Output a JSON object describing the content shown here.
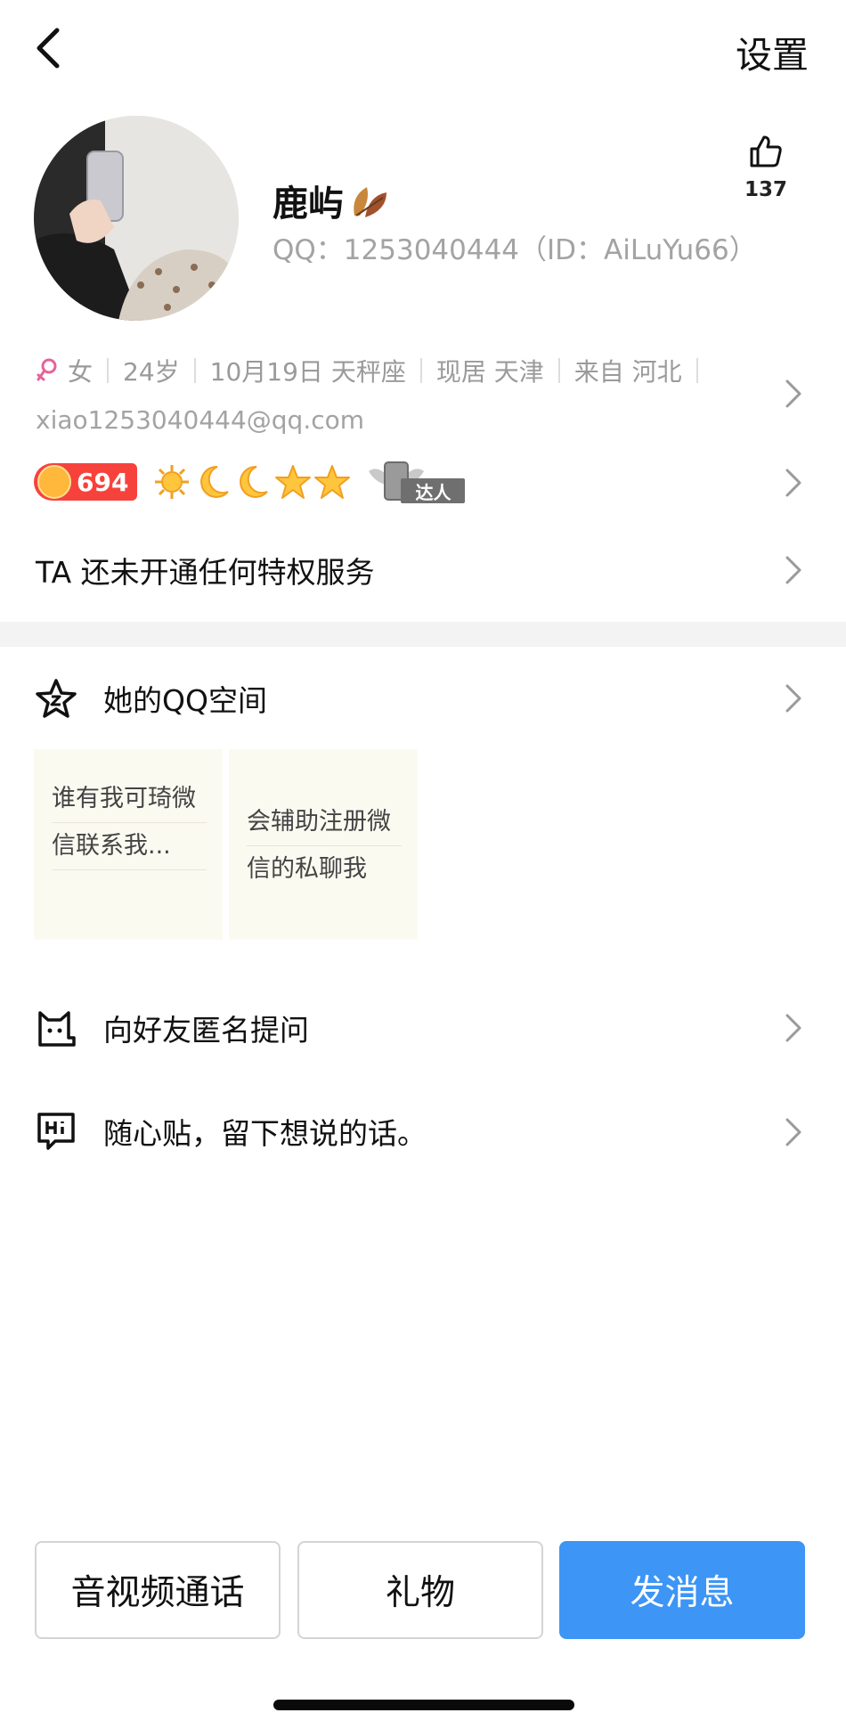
{
  "header": {
    "settings_label": "设置"
  },
  "profile": {
    "name": "鹿屿",
    "qq_id_line": "QQ：1253040444（ID：AiLuYu66）",
    "likes": "137"
  },
  "info": {
    "gender": "女",
    "age": "24岁",
    "birthday": "10月19日 天秤座",
    "current_city": "现居 天津",
    "hometown": "来自 河北",
    "email": "xiao1253040444@qq.com"
  },
  "badges": {
    "level": "694",
    "talent_label": "达人"
  },
  "privilege_text": "TA 还未开通任何特权服务",
  "qzone": {
    "label": "她的QQ空间",
    "posts": [
      {
        "line1": "谁有我可琦微",
        "line2": "信联系我..."
      },
      {
        "line1": "会辅助注册微",
        "line2": "信的私聊我"
      }
    ]
  },
  "ask_label": "向好友匿名提问",
  "note_label": "随心贴，留下想说的话。",
  "actions": {
    "call": "音视频通话",
    "gift": "礼物",
    "message": "发消息"
  },
  "colors": {
    "accent": "#3d95f5",
    "level_red": "#f7423c",
    "gender_pink": "#e8629a"
  }
}
